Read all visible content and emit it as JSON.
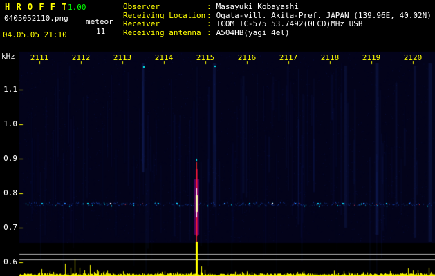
{
  "header": {
    "app_name": "H R O F F T",
    "version": "1.00",
    "filename": "0405052110.png",
    "mode_label": "meteor",
    "meteor_count": "11",
    "datetime": "04.05.05 21:10",
    "separator": ":",
    "info": [
      {
        "label": "Observer",
        "value": "Masayuki Kobayashi"
      },
      {
        "label": "Receiving Location",
        "value": "Ogata-vill. Akita-Pref. JAPAN (139.96E, 40.02N)"
      },
      {
        "label": "Receiver",
        "value": "ICOM IC-575 53.7492(0LCD)MHz USB"
      },
      {
        "label": "Receiving antenna",
        "value": "A504HB(yagi 4el)"
      }
    ]
  },
  "colors": {
    "accent_yellow": "#ffff00",
    "version_green": "#00ff00",
    "text_white": "#ffffff",
    "spectrogram_bg": "#03031a",
    "threshold_gray": "#b4b4b4",
    "echo_red": "#ff2020",
    "echo_magenta": "#ff00ff",
    "band_cyan": "#00ccff"
  },
  "chart_data": {
    "type": "heatmap",
    "kind": "radio meteor echo spectrogram with signal-strength strip (HROFFT output)",
    "x_axis": {
      "ticks": [
        "2111",
        "2112",
        "2113",
        "2114",
        "2115",
        "2116",
        "2117",
        "2118",
        "2119",
        "2120"
      ]
    },
    "y_axis": {
      "label": "kHz",
      "ticks": [
        "1.1",
        "1.0",
        "0.9",
        "0.8",
        "0.7",
        "0.6"
      ],
      "range_khz": [
        0.55,
        1.16
      ]
    },
    "carrier_band_khz": 0.77,
    "main_echo": {
      "time": 2114.78,
      "freq_span_khz": [
        0.66,
        0.89
      ],
      "intensity": "strong",
      "core_colors": [
        "#ffffff",
        "#ffffaa",
        "#ff2020",
        "#ff00ff",
        "#00ffff"
      ]
    },
    "minor_echoes": [
      {
        "time": 2111.05,
        "color": "#00ccff"
      },
      {
        "time": 2111.6,
        "color": "#2080ff"
      },
      {
        "time": 2112.15,
        "color": "#00e0ff"
      },
      {
        "time": 2112.7,
        "color": "#ffffff"
      },
      {
        "time": 2113.25,
        "color": "#2080ff"
      },
      {
        "time": 2113.85,
        "color": "#00ccff"
      },
      {
        "time": 2114.3,
        "color": "#00e0ff"
      },
      {
        "time": 2115.45,
        "color": "#2080ff"
      },
      {
        "time": 2116.05,
        "color": "#00ccff"
      },
      {
        "time": 2116.6,
        "color": "#ffffff"
      },
      {
        "time": 2117.15,
        "color": "#2080ff"
      },
      {
        "time": 2117.7,
        "color": "#00ccff"
      },
      {
        "time": 2118.3,
        "color": "#00e0ff"
      },
      {
        "time": 2118.8,
        "color": "#2080ff"
      },
      {
        "time": 2119.35,
        "color": "#00ccff"
      },
      {
        "time": 2119.9,
        "color": "#2080ff"
      }
    ],
    "strength_strip": {
      "threshold_freqs_khz": [
        0.624,
        0.608
      ],
      "spikes": [
        {
          "time": 2111.05,
          "h": 10
        },
        {
          "time": 2111.62,
          "h": 18
        },
        {
          "time": 2111.75,
          "h": 12
        },
        {
          "time": 2111.85,
          "h": 24
        },
        {
          "time": 2111.97,
          "h": 12
        },
        {
          "time": 2112.08,
          "h": 8
        },
        {
          "time": 2112.22,
          "h": 16
        },
        {
          "time": 2112.38,
          "h": 9
        },
        {
          "time": 2112.55,
          "h": 7
        },
        {
          "time": 2114.78,
          "h": 50,
          "w": 3
        },
        {
          "time": 2114.9,
          "h": 14
        },
        {
          "time": 2114.98,
          "h": 9
        },
        {
          "time": 2119.45,
          "h": 7
        },
        {
          "time": 2119.88,
          "h": 11
        },
        {
          "time": 2120.12,
          "h": 8
        },
        {
          "time": 2120.38,
          "h": 12
        }
      ]
    }
  }
}
